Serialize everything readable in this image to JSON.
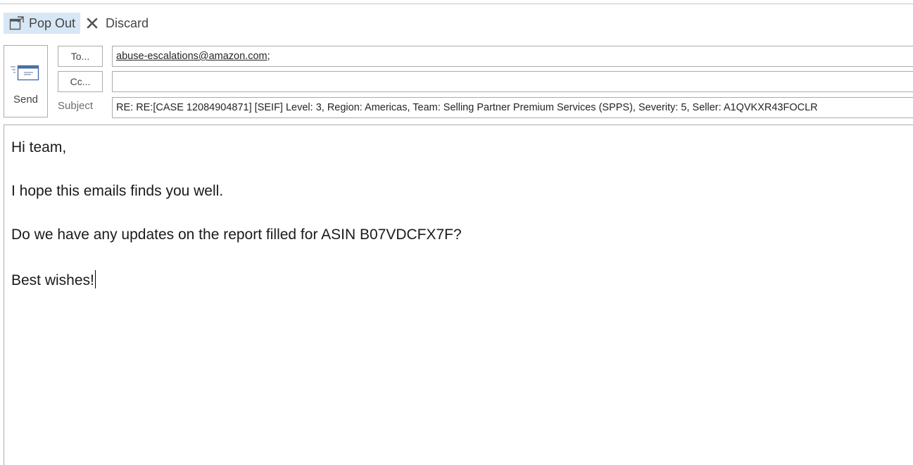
{
  "toolbar": {
    "popout_label": "Pop Out",
    "discard_label": "Discard"
  },
  "compose": {
    "send_label": "Send",
    "to_button_label": "To...",
    "cc_button_label": "Cc...",
    "subject_label": "Subject",
    "to_recipient": "abuse-escalations@amazon.com",
    "to_separator": ";",
    "cc_value": "",
    "subject_value": "RE: RE:[CASE 12084904871] [SEIF] Level: 3, Region: Americas, Team: Selling Partner Premium Services (SPPS), Severity: 5, Seller: A1QVKXR43FOCLR"
  },
  "body": {
    "lines": [
      "Hi team,",
      "I hope this emails finds you well.",
      "Do we have any updates on the report filled for ASIN B07VDCFX7F?",
      "Best wishes!"
    ]
  },
  "icons": {
    "popout": "popout-icon",
    "discard": "close-icon",
    "send": "envelope-send-icon"
  },
  "colors": {
    "popout_highlight": "#d7e7f5",
    "border": "#ababab",
    "label_text": "#444444"
  }
}
